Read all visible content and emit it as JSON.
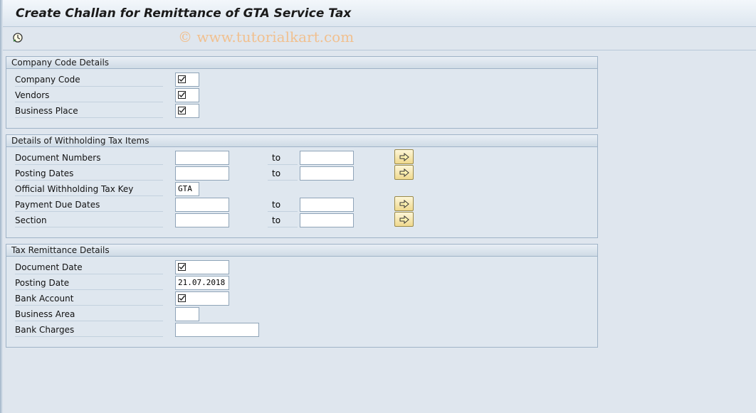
{
  "window": {
    "title": "Create Challan for Remittance of GTA Service Tax"
  },
  "toolbar": {
    "execute_icon": "execute-clock-icon",
    "watermark": "© www.tutorialkart.com"
  },
  "company_code_details": {
    "title": "Company Code Details",
    "fields": [
      {
        "label": "Company Code",
        "value": "checkbox-required-icon"
      },
      {
        "label": "Vendors",
        "value": "checkbox-required-icon"
      },
      {
        "label": "Business Place",
        "value": "checkbox-required-icon"
      }
    ]
  },
  "withholding_tax_items": {
    "title": "Details of Withholding Tax Items",
    "to_label": "to",
    "fields": [
      {
        "label": "Document Numbers",
        "from": "",
        "to": ""
      },
      {
        "label": "Posting Dates",
        "from": "",
        "to": ""
      },
      {
        "label": "Official Withholding Tax Key",
        "value": "GTA"
      },
      {
        "label": "Payment Due Dates",
        "from": "",
        "to": ""
      },
      {
        "label": "Section",
        "from": "",
        "to": ""
      }
    ]
  },
  "tax_remittance_details": {
    "title": "Tax Remittance Details",
    "fields": [
      {
        "label": "Document Date",
        "value": "checkbox-required-icon"
      },
      {
        "label": "Posting Date",
        "value": "21.07.2018"
      },
      {
        "label": "Bank Account",
        "value": "checkbox-required-icon"
      },
      {
        "label": "Business Area",
        "value": ""
      },
      {
        "label": "Bank Charges",
        "value": ""
      }
    ]
  },
  "colors": {
    "background": "#dfe6ee",
    "group_border": "#9fb3c7",
    "multiple_selection_button": "#efd98e",
    "watermark": "#f1c08f"
  }
}
